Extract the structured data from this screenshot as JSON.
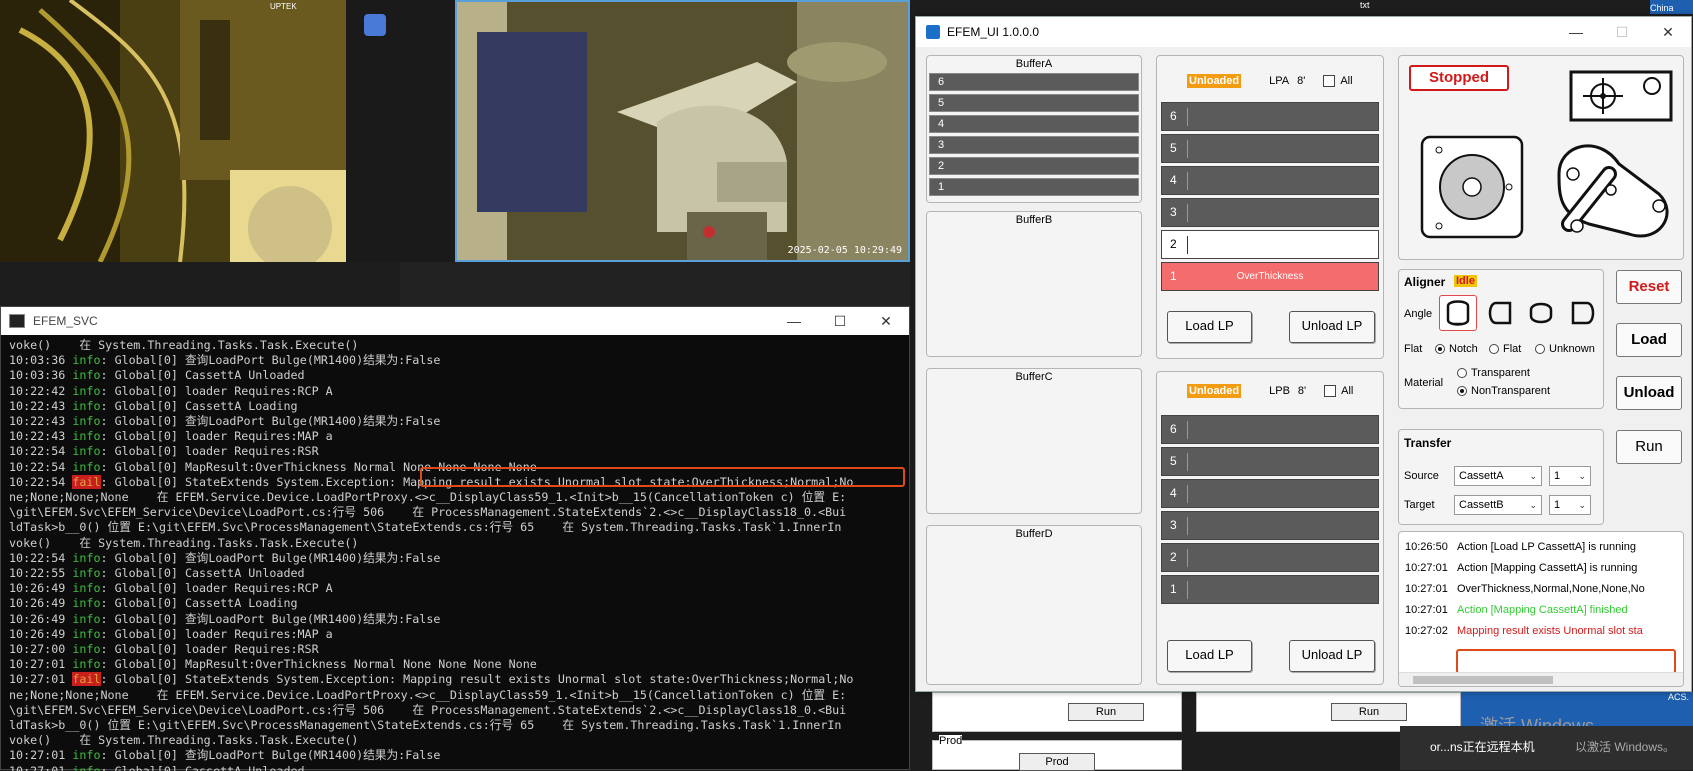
{
  "camera": {
    "overlay_brand": "UPTEK",
    "timestamp": "2025-02-05 10:29:49"
  },
  "console": {
    "title": "EFEM_SVC",
    "lines": [
      {
        "text": "voke()    在 System.Threading.Tasks.Task.Execute()"
      },
      {
        "time": "10:03:36",
        "level": "info",
        "msg": ": Global[0] 查询LoadPort Bulge(MR1400)结果为:False"
      },
      {
        "time": "10:03:36",
        "level": "info",
        "msg": ": Global[0] CassettA Unloaded"
      },
      {
        "time": "10:22:42",
        "level": "info",
        "msg": ": Global[0] loader Requires:RCP A"
      },
      {
        "time": "10:22:43",
        "level": "info",
        "msg": ": Global[0] CassettA Loading"
      },
      {
        "time": "10:22:43",
        "level": "info",
        "msg": ": Global[0] 查询LoadPort Bulge(MR1400)结果为:False"
      },
      {
        "time": "10:22:43",
        "level": "info",
        "msg": ": Global[0] loader Requires:MAP a"
      },
      {
        "time": "10:22:54",
        "level": "info",
        "msg": ": Global[0] loader Requires:RSR"
      },
      {
        "time": "10:22:54",
        "level": "info",
        "msg": ": Global[0] MapResult:OverThickness Normal None None None None"
      },
      {
        "time": "10:22:54",
        "level": "fail",
        "msg": ": Global[0] StateExtends System.Exception: Mapping result exists Unormal slot state:OverThickness;Normal;No"
      },
      {
        "text": "ne;None;None;None    在 EFEM.Service.Device.LoadPortProxy.<>c__DisplayClass59_1.<Init>b__15(CancellationToken c) 位置 E:"
      },
      {
        "text": "\\git\\EFEM.Svc\\EFEM_Service\\Device\\LoadPort.cs:行号 506    在 ProcessManagement.StateExtends`2.<>c__DisplayClass18_0.<Bui"
      },
      {
        "text": "ldTask>b__0() 位置 E:\\git\\EFEM.Svc\\ProcessManagement\\StateExtends.cs:行号 65    在 System.Threading.Tasks.Task`1.InnerIn"
      },
      {
        "text": "voke()    在 System.Threading.Tasks.Task.Execute()"
      },
      {
        "time": "10:22:54",
        "level": "info",
        "msg": ": Global[0] 查询LoadPort Bulge(MR1400)结果为:False"
      },
      {
        "time": "10:22:55",
        "level": "info",
        "msg": ": Global[0] CassettA Unloaded"
      },
      {
        "time": "10:26:49",
        "level": "info",
        "msg": ": Global[0] loader Requires:RCP A"
      },
      {
        "time": "10:26:49",
        "level": "info",
        "msg": ": Global[0] CassettA Loading"
      },
      {
        "time": "10:26:49",
        "level": "info",
        "msg": ": Global[0] 查询LoadPort Bulge(MR1400)结果为:False"
      },
      {
        "time": "10:26:49",
        "level": "info",
        "msg": ": Global[0] loader Requires:MAP a"
      },
      {
        "time": "10:27:00",
        "level": "info",
        "msg": ": Global[0] loader Requires:RSR"
      },
      {
        "time": "10:27:01",
        "level": "info",
        "msg": ": Global[0] MapResult:OverThickness Normal None None None None"
      },
      {
        "time": "10:27:01",
        "level": "fail",
        "msg": ": Global[0] StateExtends System.Exception: Mapping result exists Unormal slot state:OverThickness;Normal;No"
      },
      {
        "text": "ne;None;None;None    在 EFEM.Service.Device.LoadPortProxy.<>c__DisplayClass59_1.<Init>b__15(CancellationToken c) 位置 E:"
      },
      {
        "text": "\\git\\EFEM.Svc\\EFEM_Service\\Device\\LoadPort.cs:行号 506    在 ProcessManagement.StateExtends`2.<>c__DisplayClass18_0.<Bui"
      },
      {
        "text": "ldTask>b__0() 位置 E:\\git\\EFEM.Svc\\ProcessManagement\\StateExtends.cs:行号 65    在 System.Threading.Tasks.Task`1.InnerIn"
      },
      {
        "text": "voke()    在 System.Threading.Tasks.Task.Execute()"
      },
      {
        "time": "10:27:01",
        "level": "info",
        "msg": ": Global[0] 查询LoadPort Bulge(MR1400)结果为:False"
      },
      {
        "time": "10:27:01",
        "level": "info",
        "msg": ": Global[0] CassettA Unloaded"
      }
    ],
    "level_labels": {
      "info": "info",
      "fail": "fail"
    }
  },
  "efem": {
    "title": "EFEM_UI 1.0.0.0",
    "buffers": [
      {
        "name": "BufferA",
        "slots": [
          "6",
          "5",
          "4",
          "3",
          "2",
          "1"
        ]
      },
      {
        "name": "BufferB",
        "slots": []
      },
      {
        "name": "BufferC",
        "slots": []
      },
      {
        "name": "BufferD",
        "slots": []
      }
    ],
    "lpa": {
      "status": "Unloaded",
      "name": "LPA",
      "size": "8'",
      "all_label": "All",
      "slots": [
        {
          "n": "6",
          "state": "filled",
          "text": ""
        },
        {
          "n": "5",
          "state": "filled",
          "text": ""
        },
        {
          "n": "4",
          "state": "filled",
          "text": ""
        },
        {
          "n": "3",
          "state": "filled",
          "text": ""
        },
        {
          "n": "2",
          "state": "empty",
          "text": ""
        },
        {
          "n": "1",
          "state": "err",
          "text": "OverThickness"
        }
      ],
      "load": "Load LP",
      "unload": "Unload LP"
    },
    "lpb": {
      "status": "Unloaded",
      "name": "LPB",
      "size": "8'",
      "all_label": "All",
      "slots": [
        {
          "n": "6",
          "state": "filled",
          "text": ""
        },
        {
          "n": "5",
          "state": "filled",
          "text": ""
        },
        {
          "n": "4",
          "state": "filled",
          "text": ""
        },
        {
          "n": "3",
          "state": "filled",
          "text": ""
        },
        {
          "n": "2",
          "state": "filled",
          "text": ""
        },
        {
          "n": "1",
          "state": "filled",
          "text": ""
        }
      ],
      "load": "Load LP",
      "unload": "Unload LP"
    },
    "robot_status": "Stopped",
    "aligner": {
      "title": "Aligner",
      "status": "Idle",
      "angle_label": "Angle",
      "flat_label": "Flat",
      "flat_options": [
        "Notch",
        "Flat",
        "Unknown"
      ],
      "flat_selected": "Notch",
      "material_label": "Material",
      "material_options": [
        "Transparent",
        "NonTransparent"
      ],
      "material_selected": "NonTransparent"
    },
    "transfer": {
      "title": "Transfer",
      "source_label": "Source",
      "source": "CassettA",
      "source_slot": "1",
      "target_label": "Target",
      "target": "CassettB",
      "target_slot": "1"
    },
    "buttons": {
      "reset": "Reset",
      "load": "Load",
      "unload": "Unload",
      "run": "Run"
    },
    "log": [
      {
        "time": "10:26:50",
        "msg": "Action [Load LP CassettA] is running",
        "type": "normal"
      },
      {
        "time": "10:27:01",
        "msg": "Action [Mapping CassettA] is running",
        "type": "normal"
      },
      {
        "time": "10:27:01",
        "msg": "OverThickness,Normal,None,None,No",
        "type": "normal"
      },
      {
        "time": "10:27:01",
        "msg": "Action [Mapping CassettA] finished",
        "type": "green"
      },
      {
        "time": "10:27:02",
        "msg": "Mapping result exists Unormal slot sta",
        "type": "red"
      }
    ],
    "colors": {
      "unloaded": "#f39c12",
      "error_slot": "#f56c6c",
      "stopped": "#d21a1a"
    }
  },
  "background": {
    "run1": "Run",
    "run2": "Run",
    "prod_label": "Prod",
    "prod_btn": "Prod",
    "top_txt": "txt",
    "top_china": "China",
    "watermark1": "激活 Windows",
    "watermark2": "以激活 Windows。",
    "notify": "or...ns正在远程本机",
    "acs": "ACS."
  }
}
